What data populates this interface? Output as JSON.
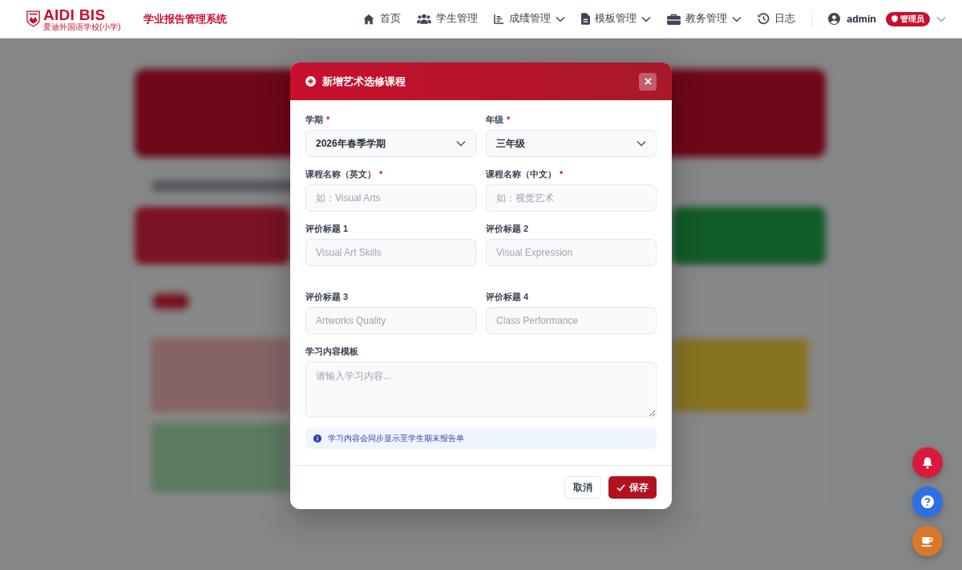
{
  "header": {
    "logo": {
      "title": "AIDI BIS",
      "subtitle": "爱迪外国语学校(小学)"
    },
    "app_title": "学业报告管理系统",
    "nav": [
      {
        "label": "首页",
        "dropdown": false
      },
      {
        "label": "学生管理",
        "dropdown": false
      },
      {
        "label": "成绩管理",
        "dropdown": true
      },
      {
        "label": "模板管理",
        "dropdown": true
      },
      {
        "label": "教务管理",
        "dropdown": true
      },
      {
        "label": "日志",
        "dropdown": false
      }
    ],
    "user": {
      "name": "admin",
      "role": "管理员"
    }
  },
  "modal": {
    "title": "新增艺术选修课程",
    "fields": [
      {
        "kind": "select",
        "label": "学期",
        "required_mark": "*",
        "value": "2026年春季学期"
      },
      {
        "kind": "select",
        "label": "年级",
        "required_mark": "*",
        "value": "三年级"
      },
      {
        "kind": "input",
        "label": "课程名称（英文）",
        "required_mark": "*",
        "placeholder": "如：Visual Arts"
      },
      {
        "kind": "input",
        "label": "课程名称（中文）",
        "required_mark": "*",
        "placeholder": "如：视觉艺术"
      },
      {
        "kind": "input",
        "label": "评价标题 1",
        "placeholder": "Visual Art Skills"
      },
      {
        "kind": "input",
        "label": "评价标题 2",
        "placeholder": "Visual Expression"
      },
      {
        "kind": "input",
        "label": "评价标题 3",
        "placeholder": "Artworks Quality"
      },
      {
        "kind": "input",
        "label": "评价标题 4",
        "placeholder": "Class Performance"
      },
      {
        "kind": "textarea",
        "label": "学习内容模板",
        "placeholder": "请输入学习内容..."
      }
    ],
    "info": "学习内容会同步显示至学生期末报告单",
    "buttons": [
      {
        "kind": "cancel",
        "label": "取消"
      },
      {
        "kind": "save",
        "label": "保存"
      }
    ]
  }
}
